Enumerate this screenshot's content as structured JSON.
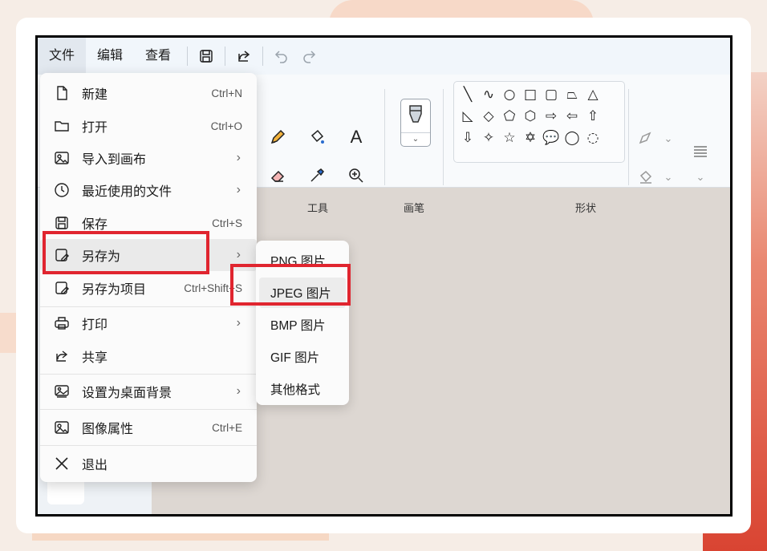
{
  "menubar": {
    "file": "文件",
    "edit": "编辑",
    "view": "查看"
  },
  "ribbon": {
    "tools_label": "工具",
    "brush_label": "画笔",
    "shapes_label": "形状"
  },
  "file_menu": {
    "items": [
      {
        "label": "新建",
        "shortcut": "Ctrl+N",
        "icon": "new-file-icon"
      },
      {
        "label": "打开",
        "shortcut": "Ctrl+O",
        "icon": "folder-icon"
      },
      {
        "label": "导入到画布",
        "shortcut": "›",
        "icon": "import-image-icon"
      },
      {
        "label": "最近使用的文件",
        "shortcut": "›",
        "icon": "clock-icon"
      },
      {
        "label": "保存",
        "shortcut": "Ctrl+S",
        "icon": "save-icon"
      },
      {
        "label": "另存为",
        "shortcut": "›",
        "icon": "save-as-icon"
      },
      {
        "label": "另存为项目",
        "shortcut": "Ctrl+Shift+S",
        "icon": "save-project-icon"
      },
      {
        "label": "打印",
        "shortcut": "›",
        "icon": "print-icon"
      },
      {
        "label": "共享",
        "shortcut": "",
        "icon": "share-icon"
      },
      {
        "label": "设置为桌面背景",
        "shortcut": "›",
        "icon": "wallpaper-icon"
      },
      {
        "label": "图像属性",
        "shortcut": "Ctrl+E",
        "icon": "image-properties-icon"
      },
      {
        "label": "退出",
        "shortcut": "",
        "icon": "close-icon"
      }
    ]
  },
  "save_as_menu": {
    "items": [
      "PNG 图片",
      "JPEG 图片",
      "BMP 图片",
      "GIF 图片",
      "其他格式"
    ]
  }
}
